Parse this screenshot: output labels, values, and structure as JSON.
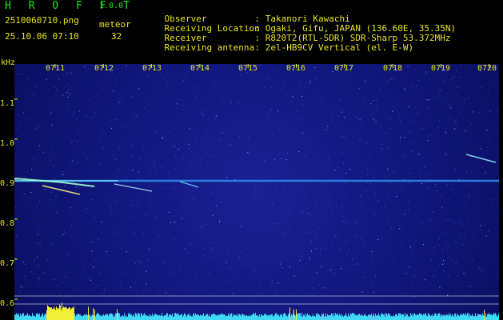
{
  "header": {
    "app_title": "H R O F F T",
    "app_version": "1.0.0",
    "file_name": "2510060710.png",
    "meteor_label": "meteor",
    "date_time": "25.10.06 07:10",
    "meteor_count": "32",
    "info": [
      {
        "key": "Observer",
        "value": ": Takanori Kawachi"
      },
      {
        "key": "Receiving Location",
        "value": ": Ogaki, Gifu, JAPAN (136.60E, 35.35N)"
      },
      {
        "key": "Receiver",
        "value": ": R820T2(RTL-SDR) SDR-Sharp 53.372MHz"
      },
      {
        "key": "Receiving antenna",
        "value": ": 2el-HB9CV Vertical (el. E-W)"
      }
    ]
  },
  "spectrogram": {
    "y_unit": "kHz",
    "y_ticks": [
      "1.1",
      "1.0",
      "0.9",
      "0.8",
      "0.7",
      "0.6"
    ],
    "x_ticks": [
      "0711",
      "0712",
      "0713",
      "0714",
      "0715",
      "0716",
      "0717",
      "0718",
      "0719",
      "0720"
    ],
    "colors": {
      "background": "#12187f",
      "trace": "#4fd7ff",
      "label": "#e6e619",
      "title": "#19e619"
    }
  }
}
